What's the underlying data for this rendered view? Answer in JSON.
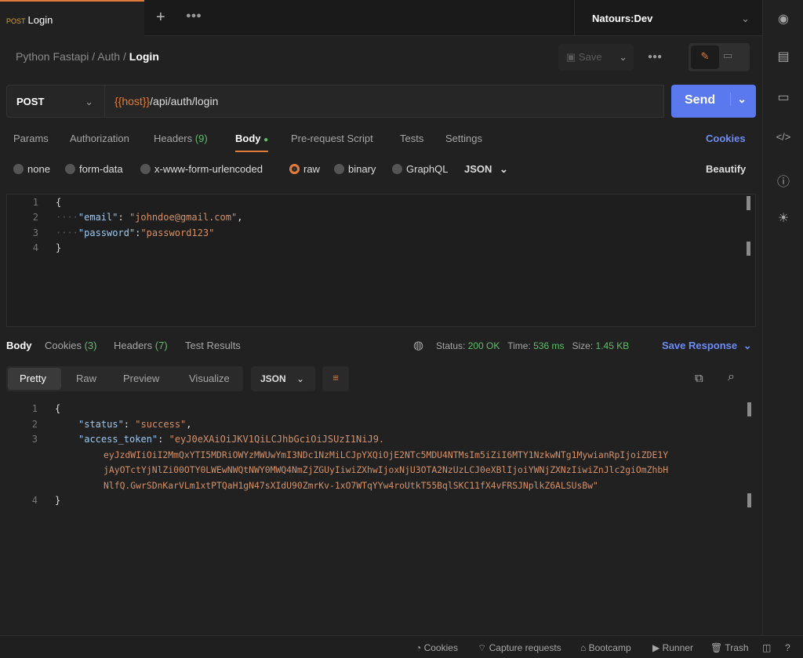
{
  "tab": {
    "method": "POST",
    "name": "Login"
  },
  "environment": "Natours:Dev",
  "breadcrumb": [
    "Python Fastapi",
    "Auth",
    "Login"
  ],
  "save_label": "Save",
  "request": {
    "method": "POST",
    "url_var": "{{host}}",
    "url_path": "/api/auth/login",
    "send_label": "Send"
  },
  "request_tabs": [
    "Params",
    "Authorization",
    "Headers",
    "(9)",
    "Body",
    "Pre-request Script",
    "Tests",
    "Settings"
  ],
  "cookies_label": "Cookies",
  "body_types": [
    "none",
    "form-data",
    "x-www-form-urlencoded",
    "raw",
    "binary",
    "GraphQL"
  ],
  "body_format": "JSON",
  "beautify_label": "Beautify",
  "request_body": {
    "email_key": "\"email\"",
    "email_val": "\"johndoe@gmail.com\"",
    "password_key": "\"password\"",
    "password_val": "\"password123\""
  },
  "response_tabs": {
    "body": "Body",
    "cookies": "Cookies",
    "cookies_count": "(3)",
    "headers": "Headers",
    "headers_count": "(7)",
    "tests": "Test Results"
  },
  "status": {
    "label": "Status:",
    "value": "200 OK",
    "time_label": "Time:",
    "time": "536 ms",
    "size_label": "Size:",
    "size": "1.45 KB"
  },
  "save_response": "Save Response",
  "view_tabs": [
    "Pretty",
    "Raw",
    "Preview",
    "Visualize"
  ],
  "response_format": "JSON",
  "response_body": {
    "status_key": "\"status\"",
    "status_val": "\"success\"",
    "token_key": "\"access_token\"",
    "token_lines": [
      "\"eyJ0eXAiOiJKV1QiLCJhbGciOiJSUzI1NiJ9.",
      "eyJzdWIiOiI2MmQxYTI5MDRiOWYzMWUwYmI3NDc1NzMiLCJpYXQiOjE2NTc5MDU4NTMsIm5iZiI6MTY1NzkwNTg1MywianRpIjoiZDE1Y",
      "jAyOTctYjNlZi00OTY0LWEwNWQtNWY0MWQ4NmZjZGUyIiwiZXhwIjoxNjU3OTA2NzUzLCJ0eXBlIjoiYWNjZXNzIiwiZnJlc2giOmZhbH",
      "NlfQ.GwrSDnKarVLm1xtPTQaH1gN47sXIdU90ZmrKv-1xO7WTqYYw4roUtkT55BqlSKC11fX4vFRSJNplkZ6ALSUsBw\""
    ]
  },
  "footer": [
    "Cookies",
    "Capture requests",
    "Bootcamp",
    "Runner",
    "Trash"
  ],
  "colors": {
    "accent": "#5b79ef",
    "orange": "#e07b39",
    "status_green": "#5fbf6a"
  }
}
